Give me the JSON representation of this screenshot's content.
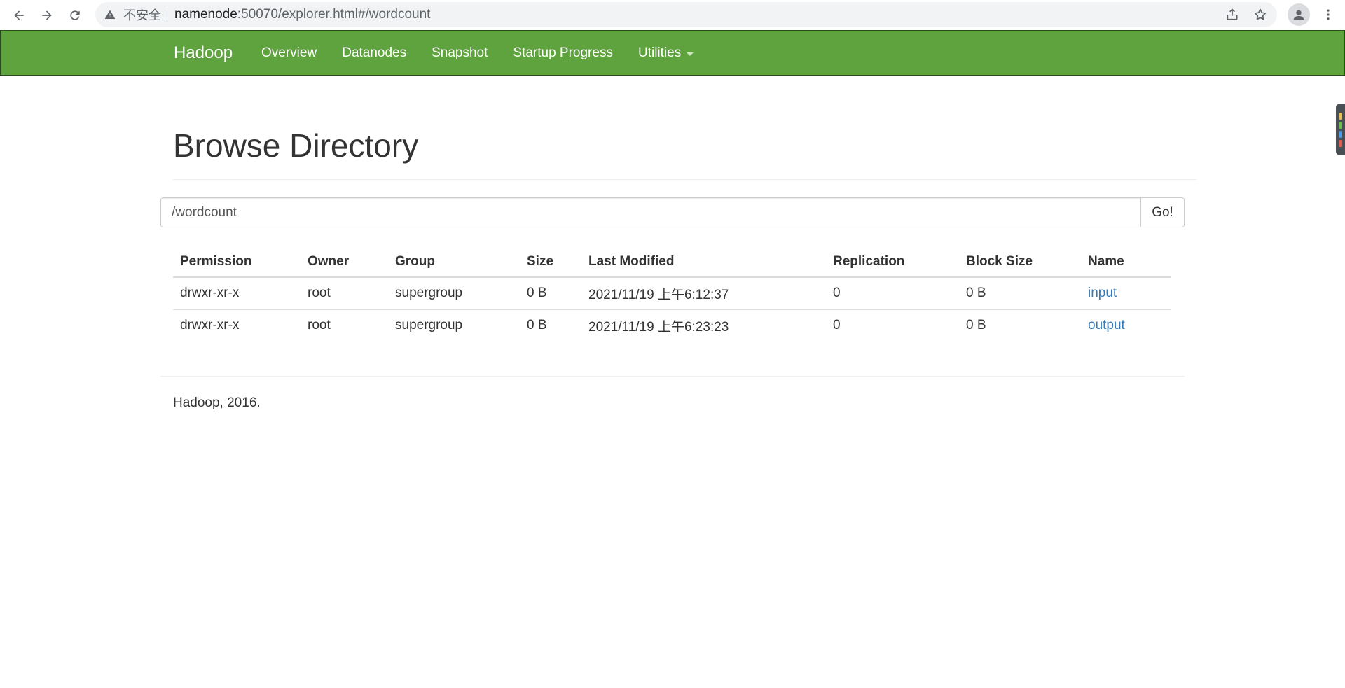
{
  "browser": {
    "security_label": "不安全",
    "url_host": "namenode",
    "url_rest": ":50070/explorer.html#/wordcount"
  },
  "navbar": {
    "brand": "Hadoop",
    "items": [
      "Overview",
      "Datanodes",
      "Snapshot",
      "Startup Progress",
      "Utilities"
    ],
    "color": "#5fa33e"
  },
  "page": {
    "title": "Browse Directory",
    "path_value": "/wordcount",
    "go_label": "Go!"
  },
  "table": {
    "headers": [
      "Permission",
      "Owner",
      "Group",
      "Size",
      "Last Modified",
      "Replication",
      "Block Size",
      "Name"
    ],
    "rows": [
      {
        "permission": "drwxr-xr-x",
        "owner": "root",
        "group": "supergroup",
        "size": "0 B",
        "modified": "2021/11/19 上午6:12:37",
        "replication": "0",
        "block_size": "0 B",
        "name": "input"
      },
      {
        "permission": "drwxr-xr-x",
        "owner": "root",
        "group": "supergroup",
        "size": "0 B",
        "modified": "2021/11/19 上午6:23:23",
        "replication": "0",
        "block_size": "0 B",
        "name": "output"
      }
    ],
    "link_color": "#337ab7"
  },
  "footer": {
    "text": "Hadoop, 2016."
  }
}
